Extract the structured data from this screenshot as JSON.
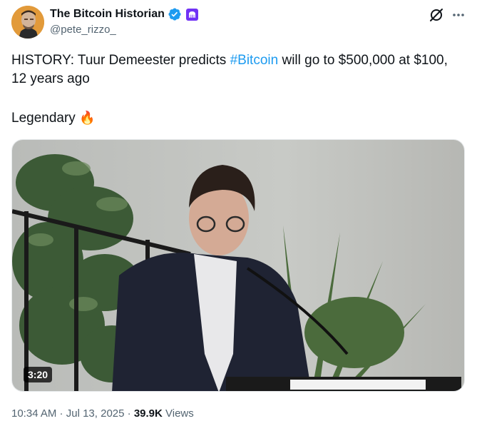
{
  "author": {
    "display_name": "The Bitcoin Historian",
    "handle": "@pete_rizzo_",
    "avatar_icon": "person-avatar",
    "verified_icon": "verified-badge-icon",
    "affiliate_icon": "kraken-affiliate-icon"
  },
  "tweet": {
    "text_before": "HISTORY: Tuur Demeester predicts ",
    "hashtag": "#Bitcoin",
    "text_after": " will go to $500,000 at $100, 12 years ago",
    "para2_text": "Legendary ",
    "para2_emoji": "🔥"
  },
  "media": {
    "duration": "3:20"
  },
  "meta": {
    "time": "10:34 AM",
    "sep1": " · ",
    "date": "Jul 13, 2025",
    "sep2": " · ",
    "views_count": "39.9K",
    "views_label": " Views"
  },
  "colors": {
    "accent": "#1d9bf0",
    "text": "#0f1419",
    "muted": "#536471",
    "affiliate": "#7132f5"
  }
}
